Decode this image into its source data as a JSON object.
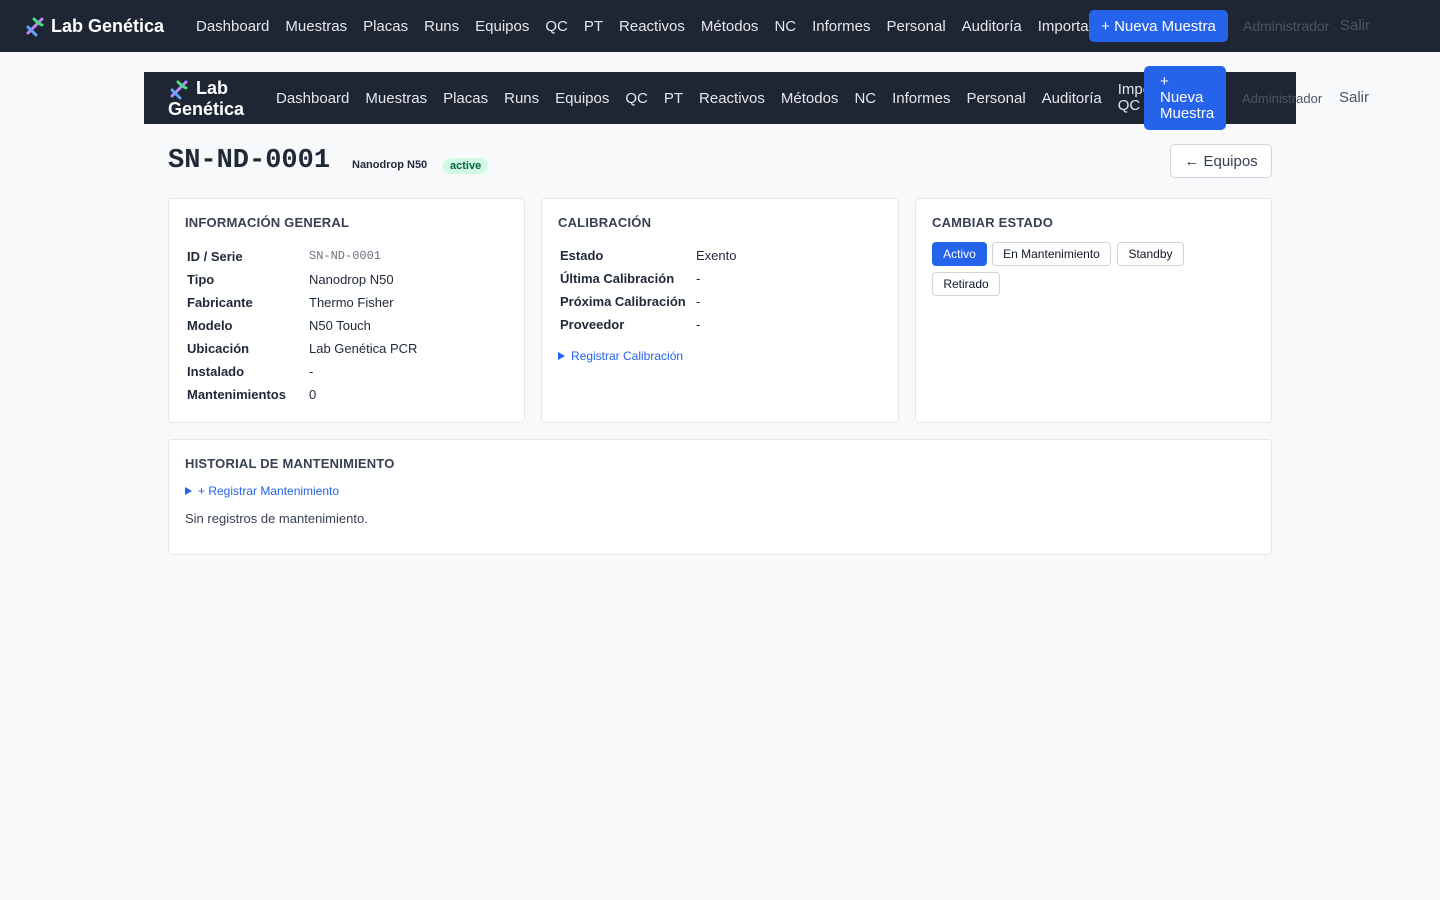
{
  "brand": {
    "name": "Lab Genética",
    "icon": "dna-icon"
  },
  "nav": {
    "items": [
      "Dashboard",
      "Muestras",
      "Placas",
      "Runs",
      "Equipos",
      "QC",
      "PT",
      "Reactivos",
      "Métodos",
      "NC",
      "Informes",
      "Personal",
      "Auditoría",
      "Importar QC"
    ],
    "new_sample": "+ Nueva Muestra",
    "user": "Administrador",
    "logout": "Salir"
  },
  "header": {
    "title": "SN-ND-0001",
    "subtitle": "Nanodrop N50",
    "status": "active",
    "back": "← Equipos"
  },
  "general": {
    "title": "Información General",
    "rows": [
      {
        "k": "ID / Serie",
        "v": "SN-ND-0001"
      },
      {
        "k": "Tipo",
        "v": "Nanodrop N50"
      },
      {
        "k": "Fabricante",
        "v": "Thermo Fisher"
      },
      {
        "k": "Modelo",
        "v": "N50 Touch"
      },
      {
        "k": "Ubicación",
        "v": "Lab Genética PCR"
      },
      {
        "k": "Instalado",
        "v": "-"
      },
      {
        "k": "Mantenimientos",
        "v": "0"
      }
    ]
  },
  "calibration": {
    "title": "Calibración",
    "rows": [
      {
        "k": "Estado",
        "v": "Exento"
      },
      {
        "k": "Última Calibración",
        "v": "-"
      },
      {
        "k": "Próxima Calibración",
        "v": "-"
      },
      {
        "k": "Proveedor",
        "v": "-"
      }
    ],
    "register": "Registrar Calibración"
  },
  "state": {
    "title": "Cambiar Estado",
    "options": [
      "Activo",
      "En Mantenimiento",
      "Standby",
      "Retirado"
    ],
    "current": "Activo"
  },
  "maintenance": {
    "title": "Historial de Mantenimiento",
    "register": "+ Registrar Mantenimiento",
    "empty": "Sin registros de mantenimiento."
  },
  "colors": {
    "nav_bg": "#1e2533",
    "primary": "#2563eb",
    "badge_bg": "#d1fae5",
    "badge_fg": "#065f46"
  }
}
